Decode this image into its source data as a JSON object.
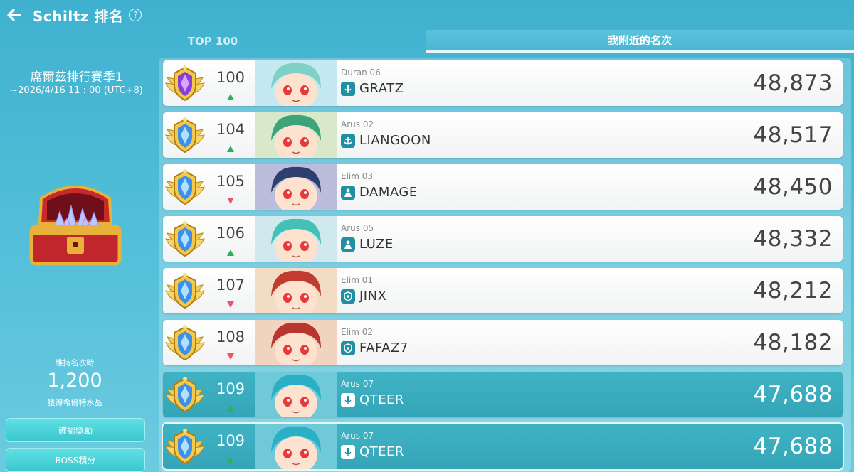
{
  "header": {
    "title": "Schiltz 排名",
    "help": "?"
  },
  "tabs": [
    {
      "label": "TOP 100"
    },
    {
      "label": "我附近的名次"
    }
  ],
  "sidebar": {
    "season_name": "席爾茲排行賽季1",
    "season_date": "~2026/4/16 11 : 00 (UTC+8)",
    "keep_label": "維持名次時",
    "reward_amount": "1,200",
    "reward_label": "獲得希爾特水晶",
    "confirm_button": "確認獎勵",
    "boss_button": "BOSS積分"
  },
  "colors": {
    "up": "#2fae5c",
    "down": "#e8556b",
    "accent": "#3fb3c4"
  },
  "rows": [
    {
      "rank": "100",
      "trend": "up",
      "server": "Duran 06",
      "name": "GRATZ",
      "score": "48,873",
      "badge": "purple-wing-badge",
      "class_icon": "microphone-icon"
    },
    {
      "rank": "104",
      "trend": "up",
      "server": "Arus 02",
      "name": "LIANGOON",
      "score": "48,517",
      "badge": "blue-wing-badge",
      "class_icon": "anchor-icon"
    },
    {
      "rank": "105",
      "trend": "down",
      "server": "Elim 03",
      "name": "DAMAGE",
      "score": "48,450",
      "badge": "blue-wing-badge",
      "class_icon": "summoner-icon"
    },
    {
      "rank": "106",
      "trend": "up",
      "server": "Arus 05",
      "name": "LUZE",
      "score": "48,332",
      "badge": "blue-wing-badge",
      "class_icon": "summoner-icon"
    },
    {
      "rank": "107",
      "trend": "down",
      "server": "Elim 01",
      "name": "JINX",
      "score": "48,212",
      "badge": "blue-wing-badge",
      "class_icon": "shield-icon"
    },
    {
      "rank": "108",
      "trend": "down",
      "server": "Elim 02",
      "name": "FAFAZ7",
      "score": "48,182",
      "badge": "blue-wing-badge",
      "class_icon": "shield-icon"
    },
    {
      "rank": "109",
      "trend": "up",
      "server": "Arus 07",
      "name": "QTEER",
      "score": "47,688",
      "badge": "blue-wing-badge",
      "class_icon": "microphone-icon",
      "highlight": true
    },
    {
      "rank": "109",
      "trend": "up",
      "server": "Arus 07",
      "name": "QTEER",
      "score": "47,688",
      "badge": "blue-wing-badge",
      "class_icon": "microphone-icon",
      "self": true
    }
  ]
}
